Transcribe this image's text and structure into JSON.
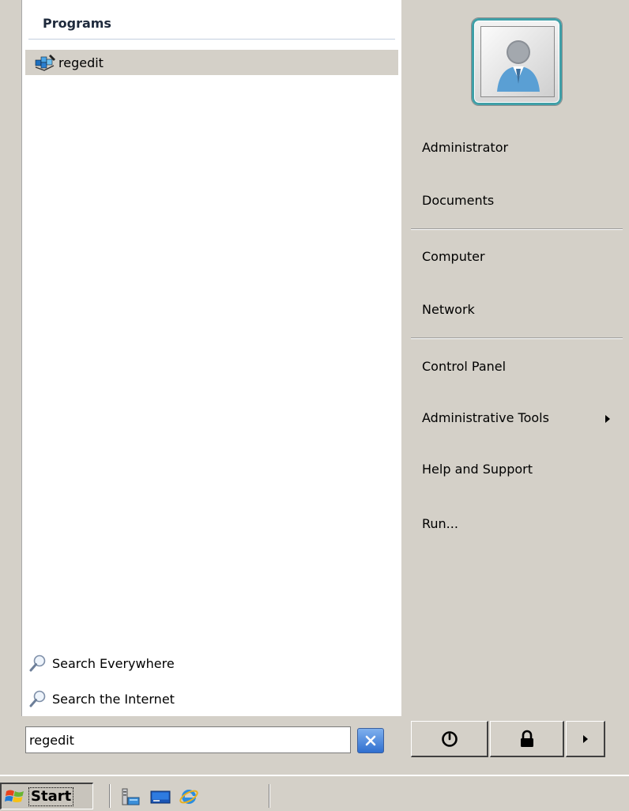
{
  "left": {
    "programs_header": "Programs",
    "programs": [
      {
        "label": "regedit",
        "icon": "regedit-icon"
      }
    ],
    "search_everywhere": "Search Everywhere",
    "search_internet": "Search the Internet"
  },
  "right": {
    "user_picture_icon": "user-avatar-icon",
    "items": {
      "administrator": "Administrator",
      "documents": "Documents",
      "computer": "Computer",
      "network": "Network",
      "control_panel": "Control Panel",
      "administrative_tools": "Administrative Tools",
      "help_and_support": "Help and Support",
      "run": "Run..."
    }
  },
  "search_box": {
    "value": "regedit"
  },
  "taskbar": {
    "start_label": "Start"
  },
  "colors": {
    "menu_bg": "#d4d0c8",
    "left_panel_bg": "#ffffff",
    "selection": "#d4d0c8",
    "clear_button": "#2f6fd0"
  }
}
